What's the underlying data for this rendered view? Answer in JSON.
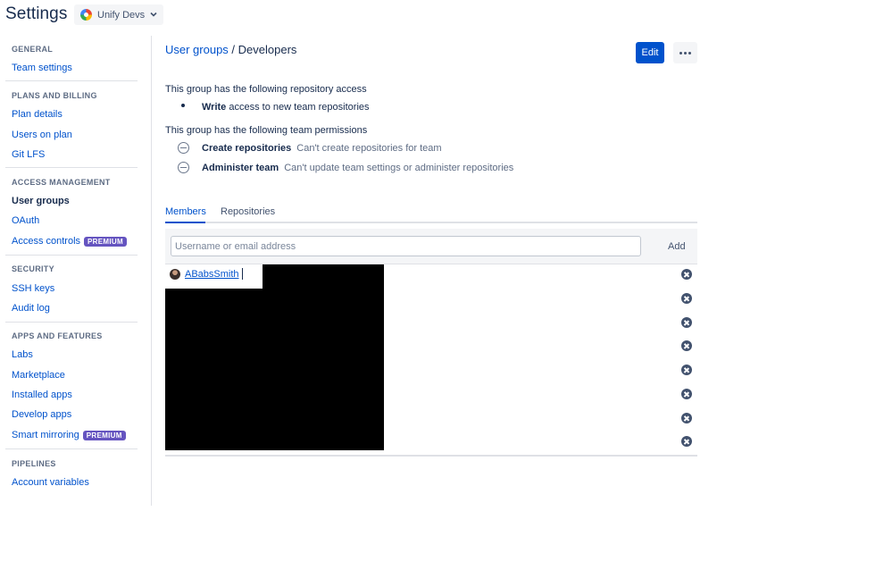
{
  "header": {
    "title": "Settings",
    "workspace": "Unify Devs"
  },
  "sidebar": {
    "sections": [
      {
        "heading": "GENERAL",
        "items": [
          {
            "label": "Team settings"
          }
        ]
      },
      {
        "heading": "PLANS AND BILLING",
        "items": [
          {
            "label": "Plan details"
          },
          {
            "label": "Users on plan"
          },
          {
            "label": "Git LFS"
          }
        ]
      },
      {
        "heading": "ACCESS MANAGEMENT",
        "items": [
          {
            "label": "User groups",
            "active": true
          },
          {
            "label": "OAuth"
          },
          {
            "label": "Access controls",
            "badge": "PREMIUM"
          }
        ]
      },
      {
        "heading": "SECURITY",
        "items": [
          {
            "label": "SSH keys"
          },
          {
            "label": "Audit log"
          }
        ]
      },
      {
        "heading": "APPS AND FEATURES",
        "items": [
          {
            "label": "Labs"
          },
          {
            "label": "Marketplace"
          },
          {
            "label": "Installed apps"
          },
          {
            "label": "Develop apps"
          },
          {
            "label": "Smart mirroring",
            "badge": "PREMIUM"
          }
        ]
      },
      {
        "heading": "PIPELINES",
        "items": [
          {
            "label": "Account variables"
          }
        ]
      }
    ]
  },
  "breadcrumb": {
    "parent": "User groups",
    "separator": " / ",
    "current": "Developers"
  },
  "actions": {
    "edit_label": "Edit"
  },
  "repo_access": {
    "heading": "This group has the following repository access",
    "permission": "Write",
    "description": "access to new team repositories"
  },
  "team_permissions": {
    "heading": "This group has the following team permissions",
    "items": [
      {
        "name": "Create repositories",
        "description": "Can't create repositories for team",
        "state": "denied"
      },
      {
        "name": "Administer team",
        "description": "Can't update team settings or administer repositories",
        "state": "denied"
      }
    ]
  },
  "tabs": [
    {
      "label": "Members",
      "active": true
    },
    {
      "label": "Repositories",
      "active": false
    }
  ],
  "add_member": {
    "placeholder": "Username or email address",
    "button_label": "Add"
  },
  "members": {
    "visible_name": "ABabsSmith",
    "remove_count": 8
  },
  "colors": {
    "accent": "#0052cc",
    "premium_badge": "#6554c0",
    "text": "#172b4d"
  }
}
